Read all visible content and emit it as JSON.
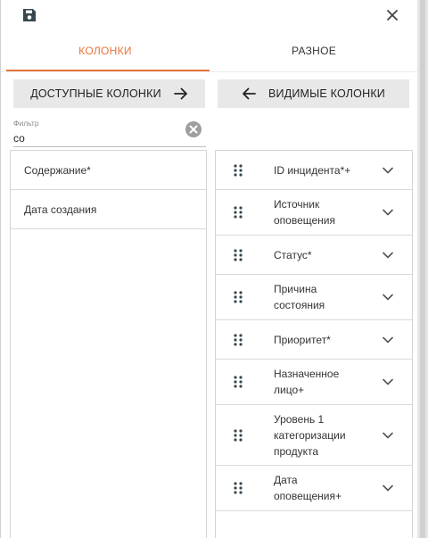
{
  "toolbar": {
    "save_icon": "save-icon",
    "close_icon": "close-icon"
  },
  "tabs": [
    {
      "label": "КОЛОНКИ",
      "active": true
    },
    {
      "label": "РАЗНОЕ",
      "active": false
    }
  ],
  "buttons": {
    "available_label": "ДОСТУПНЫЕ КОЛОНКИ",
    "visible_label": "ВИДИМЫЕ КОЛОНКИ"
  },
  "filter": {
    "label": "Фильтр",
    "value": "со"
  },
  "available_columns": [
    {
      "label": "Содержание*"
    },
    {
      "label": "Дата создания"
    }
  ],
  "visible_columns": [
    {
      "label": "ID инцидента*+"
    },
    {
      "label": "Источник оповещения"
    },
    {
      "label": "Статус*"
    },
    {
      "label": "Причина состояния"
    },
    {
      "label": "Приоритет*"
    },
    {
      "label": "Назначенное лицо+"
    },
    {
      "label": "Уровень 1 категоризации продукта"
    },
    {
      "label": "Дата оповещения+"
    }
  ],
  "colors": {
    "accent": "#e8743b",
    "button_bg": "#e8e8e8",
    "border": "#d4d4d4"
  }
}
